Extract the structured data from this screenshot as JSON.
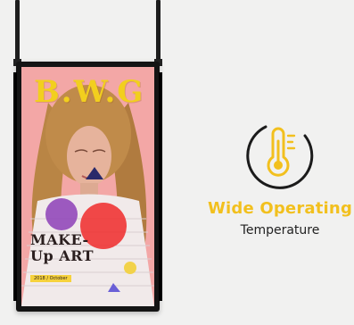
{
  "poster": {
    "brand": "B.W.G",
    "headline_line1": "MAKE-",
    "headline_line2": "Up ART",
    "date_tag": "2018 / October"
  },
  "feature": {
    "title": "Wide Operating",
    "subtitle": "Temperature",
    "icon": "thermometer-icon",
    "accent_color": "#f2c01e"
  }
}
